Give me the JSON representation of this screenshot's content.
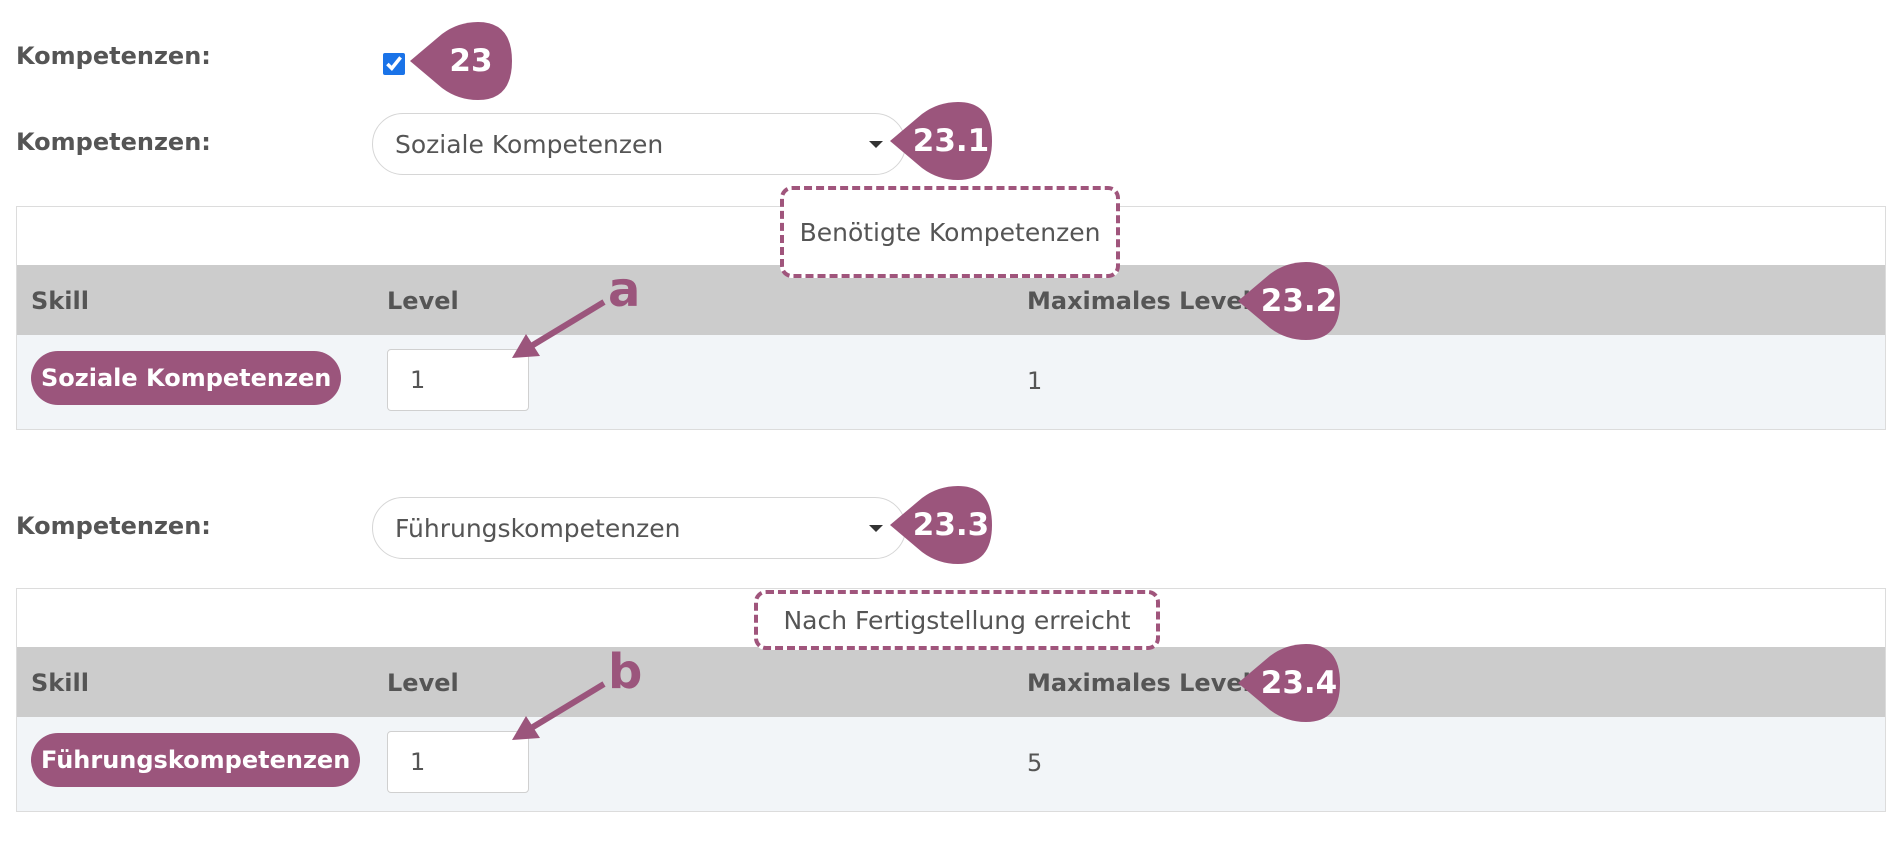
{
  "colors": {
    "accent": "#9b557c",
    "header_bg": "#cccccc",
    "row_bg": "#f2f5f8",
    "checkbox": "#1a73e8"
  },
  "section1": {
    "checkbox_label": "Kompetenzen:",
    "checkbox_checked": true,
    "checkbox_badge": "23",
    "select_label": "Kompetenzen:",
    "select_value": "Soziale Kompetenzen",
    "select_badge": "23.1",
    "table": {
      "caption": "Benötigte Kompetenzen",
      "headers": {
        "skill": "Skill",
        "level": "Level",
        "max_level": "Maximales Level"
      },
      "header_badge": "23.2",
      "row": {
        "skill": "Soziale Kompetenzen",
        "level": "1",
        "max_level": "1"
      },
      "pointer_letter": "a"
    }
  },
  "section2": {
    "select_label": "Kompetenzen:",
    "select_value": "Führungskompetenzen",
    "select_badge": "23.3",
    "table": {
      "caption": "Nach Fertigstellung erreicht",
      "headers": {
        "skill": "Skill",
        "level": "Level",
        "max_level": "Maximales Level"
      },
      "header_badge": "23.4",
      "row": {
        "skill": "Führungskompetenzen",
        "level": "1",
        "max_level": "5"
      },
      "pointer_letter": "b"
    }
  }
}
